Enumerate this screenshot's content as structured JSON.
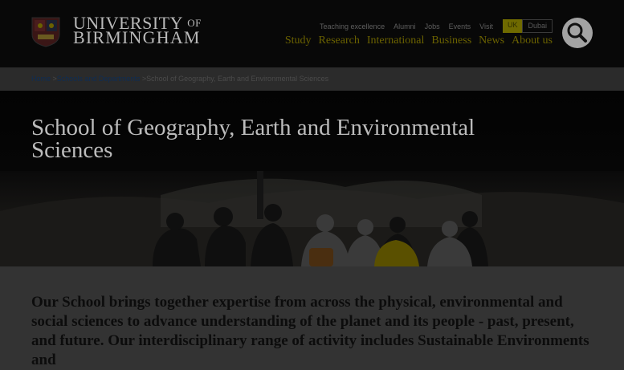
{
  "header": {
    "logo_line1": "UNIVERSITY",
    "logo_of": "OF",
    "logo_line2": "BIRMINGHAM",
    "utility_links": [
      "Teaching excellence",
      "Alumni",
      "Jobs",
      "Events",
      "Visit"
    ],
    "campus": {
      "selected": "UK",
      "other": "Dubai"
    },
    "main_nav": [
      "Study",
      "Research",
      "International",
      "Business",
      "News",
      "About us"
    ],
    "search_icon": "search-icon"
  },
  "breadcrumb": {
    "home": "Home",
    "separator": ">",
    "schools": "Schools and Departments",
    "current": "School of Geography, Earth and Environmental Sciences"
  },
  "hero": {
    "title": "School of Geography, Earth and Environmental Sciences"
  },
  "intro": {
    "text": "Our School brings together expertise from across the physical, environmental and social sciences to advance understanding of the planet and its people - past, present, and future. Our interdisciplinary range of activity includes Sustainable Environments and"
  },
  "colors": {
    "header_bg": "#080808",
    "nav_gold": "#6b6200",
    "campus_uk": "#6f6a00",
    "link_blue": "#0e2d55",
    "overlay": "#333333"
  }
}
